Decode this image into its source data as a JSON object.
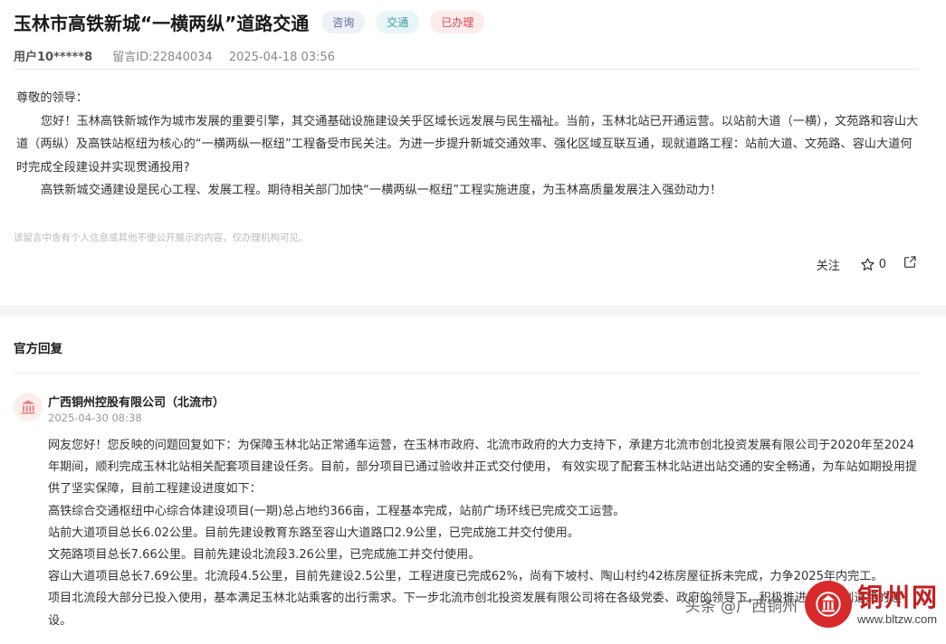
{
  "header": {
    "title": "玉林市高铁新城“一横两纵”道路交通",
    "tags": [
      "咨询",
      "交通",
      "已办理"
    ],
    "user": "用户10*****8",
    "message_id": "留言ID:22840034",
    "datetime": "2025-04-18 03:56"
  },
  "message": {
    "salutation": "尊敬的领导：",
    "paragraphs": [
      "您好！玉林高铁新城作为城市发展的重要引擎，其交通基础设施建设关乎区域长远发展与民生福祉。当前，玉林北站已开通运营。以站前大道（一横），文苑路和容山大道（两纵）及高铁站枢纽为核心的“一横两纵一枢纽”工程备受市民关注。为进一步提升新城交通效率、强化区域互联互通，现就道路工程：站前大道、文苑路、容山大道何时完成全段建设并实现贯通投用?",
      "高铁新城交通建设是民心工程、发展工程。期待相关部门加快“一横两纵一枢纽”工程实施进度，为玉林高质量发展注入强劲动力！"
    ],
    "disclaimer": "该留言中含有个人信息或其他不便公开展示的内容，仅办理机构可见。"
  },
  "actions": {
    "follow_label": "关注",
    "like_count": "0"
  },
  "reply": {
    "section_title": "官方回复",
    "org_name": "广西铜州控股有限公司（北流市）",
    "date": "2025-04-30 08:38",
    "lines": [
      "网友您好！您反映的问题回复如下：为保障玉林北站正常通车运营，在玉林市政府、北流市政府的大力支持下，承建方北流市创北投资发展有限公司于2020年至2024年期间，顺利完成玉林北站相关配套项目建设任务。目前，部分项目已通过验收并正式交付使用， 有效实现了配套玉林北站进出站交通的安全畅通，为车站如期投用提供了坚实保障，目前工程建设进度如下：",
      "高铁综合交通枢纽中心综合体建设项目(一期)总占地约366亩，工程基本完成，站前广场环线已完成交工运营。",
      "站前大道项目总长6.02公里。目前先建设教育东路至容山大道路口2.9公里，已完成施工并交付使用。",
      "文苑路项目总长7.66公里。目前先建设北流段3.26公里，已完成施工并交付使用。",
      "容山大道项目总长7.69公里。北流段4.5公里，目前先建设2.5公里，工程进度已完成62%，尚有下坡村、陶山村约42栋房屋征拆未完成，力争2025年内完工。",
      "项目北流段大部分已投入使用，基本满足玉林北站乘客的出行需求。下一步北流市创北投资发展有限公司将在各级党委、政府的领导下，积极推进剩余规划道路的建设。"
    ]
  },
  "watermark": {
    "left_text": "头条 @广西铜州",
    "brand": "铜州网",
    "url": "www.bltzw.com"
  }
}
